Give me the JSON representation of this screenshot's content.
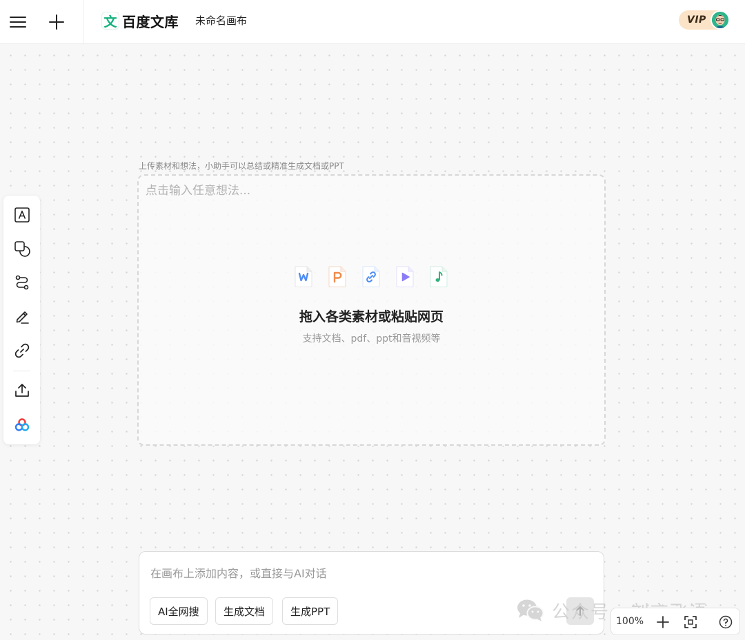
{
  "header": {
    "logo_mark": "文",
    "brand": "百度文库",
    "document_title": "未命名画布",
    "vip_label": "VIP"
  },
  "toolbar": {
    "items": [
      {
        "icon": "text-icon",
        "name": "text"
      },
      {
        "icon": "shapes-icon",
        "name": "shapes"
      },
      {
        "icon": "connector-icon",
        "name": "connector"
      },
      {
        "icon": "pen-icon",
        "name": "pen"
      },
      {
        "icon": "link-icon",
        "name": "link"
      },
      {
        "icon": "upload-icon",
        "name": "upload"
      },
      {
        "icon": "baidu-netdisk-icon",
        "name": "netdisk"
      }
    ]
  },
  "upload": {
    "hint": "上传素材和想法，小助手可以总结或精准生成文档或PPT",
    "placeholder": "点击输入任意想法...",
    "file_types": [
      {
        "icon": "word-file-icon",
        "letter": "W",
        "color": "#4e8df5"
      },
      {
        "icon": "ppt-file-icon",
        "letter": "P",
        "color": "#f08a4b"
      },
      {
        "icon": "link-file-icon",
        "letter": "",
        "color": "#4e8df5"
      },
      {
        "icon": "video-file-icon",
        "letter": "",
        "color": "#8b7cf6"
      },
      {
        "icon": "audio-file-icon",
        "letter": "",
        "color": "#34b27d"
      }
    ],
    "title": "拖入各类素材或粘贴网页",
    "subtitle": "支持文档、pdf、ppt和音视频等"
  },
  "chat": {
    "placeholder": "在画布上添加内容，或直接与AI对话",
    "chips": [
      "AI全网搜",
      "生成文档",
      "生成PPT"
    ]
  },
  "watermark": {
    "text": "公众号 · 刘言飞语"
  },
  "zoom": {
    "level": "100%"
  }
}
